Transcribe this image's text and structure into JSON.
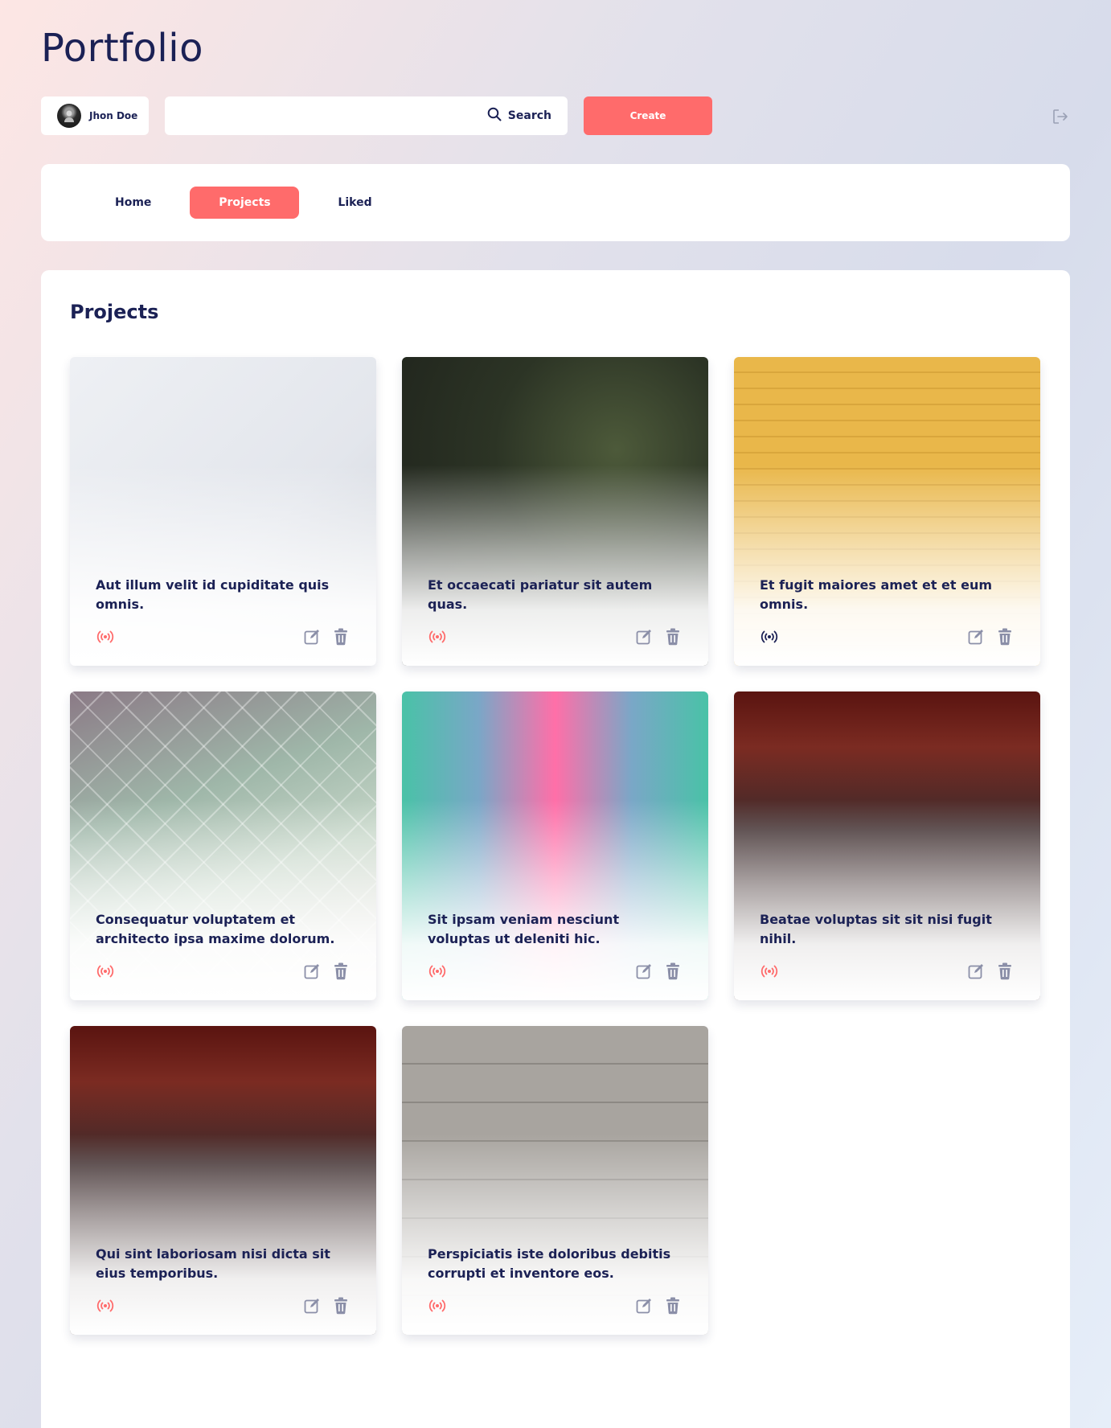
{
  "app": {
    "logo": "Portfolio"
  },
  "user": {
    "name": "Jhon Doe"
  },
  "search": {
    "placeholder": "",
    "button_label": "Search"
  },
  "create_button": "Create",
  "nav": {
    "tabs": [
      {
        "label": "Home",
        "active": false
      },
      {
        "label": "Projects",
        "active": true
      },
      {
        "label": "Liked",
        "active": false
      }
    ]
  },
  "main": {
    "title": "Projects",
    "projects": [
      {
        "title": "Aut illum velit id cupiditate quis omnis.",
        "broadcast_color": "#ff6b6b"
      },
      {
        "title": "Et occaecati pariatur sit autem quas.",
        "broadcast_color": "#ff6b6b"
      },
      {
        "title": "Et fugit maiores amet et et eum omnis.",
        "broadcast_color": "#1b2155"
      },
      {
        "title": "Consequatur voluptatem et architecto ipsa maxime dolorum.",
        "broadcast_color": "#ff6b6b"
      },
      {
        "title": "Sit ipsam veniam nesciunt voluptas ut deleniti hic.",
        "broadcast_color": "#ff6b6b"
      },
      {
        "title": "Beatae voluptas sit sit nisi fugit nihil.",
        "broadcast_color": "#ff6b6b"
      },
      {
        "title": "Qui sint laboriosam nisi dicta sit eius temporibus.",
        "broadcast_color": "#ff6b6b"
      },
      {
        "title": "Perspiciatis iste doloribus debitis corrupti et inventore eos.",
        "broadcast_color": "#ff6b6b"
      }
    ]
  },
  "colors": {
    "accent": "#ff6b6b",
    "text": "#1b2155",
    "muted_icon": "#8b8fa8"
  },
  "icons": [
    "search-icon",
    "logout-icon",
    "broadcast-icon",
    "edit-icon",
    "trash-icon"
  ]
}
